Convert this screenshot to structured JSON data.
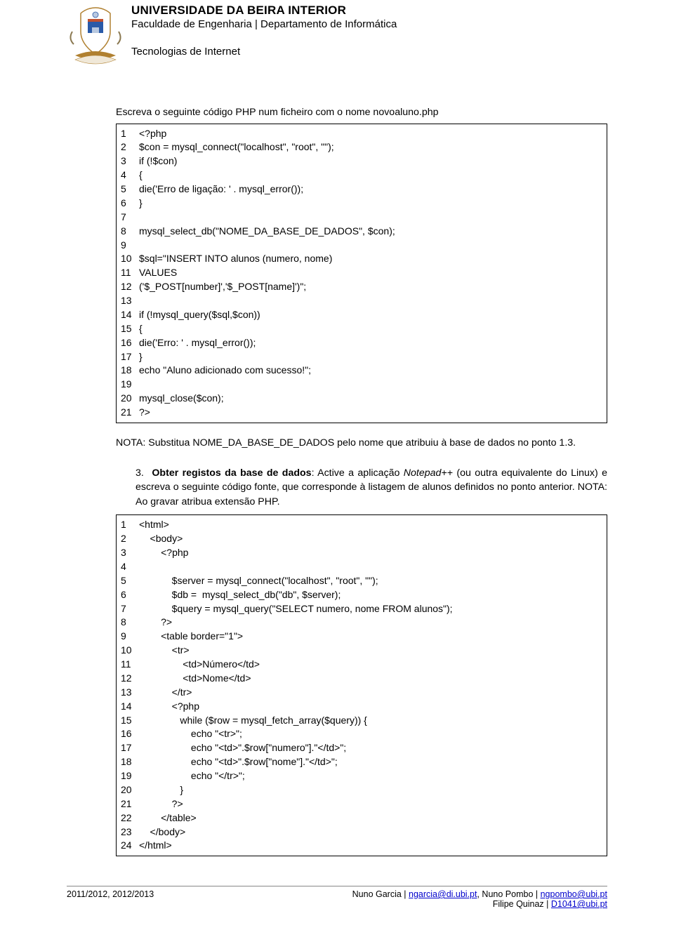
{
  "header": {
    "line1": "UNIVERSIDADE DA BEIRA INTERIOR",
    "line2": "Faculdade de Engenharia | Departamento de Informática",
    "line3": "Tecnologias de Internet"
  },
  "intro": "Escreva o seguinte código PHP num ficheiro com o nome novoaluno.php",
  "code1": {
    "linenums": "1\n2\n3\n4\n5\n6\n7\n8\n9\n10\n11\n12\n13\n14\n15\n16\n17\n18\n19\n20\n21",
    "text": "<?php\n$con = mysql_connect(\"localhost\", \"root\", \"\");\nif (!$con)\n{\ndie('Erro de ligação: ' . mysql_error());\n}\n\nmysql_select_db(\"NOME_DA_BASE_DE_DADOS\", $con);\n\n$sql=\"INSERT INTO alunos (numero, nome)\nVALUES\n('$_POST[number]','$_POST[name]')\";\n\nif (!mysql_query($sql,$con))\n{\ndie('Erro: ' . mysql_error());\n}\necho \"Aluno adicionado com sucesso!\";\n\nmysql_close($con);\n?>"
  },
  "note": "NOTA: Substitua NOME_DA_BASE_DE_DADOS pelo nome que atribuiu à base de dados no ponto 1.3.",
  "step3": {
    "num": "3.",
    "bold": "Obter registos da base de dados",
    "rest1": ": Active a aplicação ",
    "em": "Notepad++",
    "rest2": " (ou outra equivalente do Linux) e escreva o seguinte código fonte, que corresponde à listagem de alunos definidos no ponto anterior. NOTA: Ao gravar atribua extensão PHP."
  },
  "code2": {
    "linenums": "1\n2\n3\n4\n5\n6\n7\n8\n9\n10\n11\n12\n13\n14\n15\n16\n17\n18\n19\n20\n21\n22\n23\n24",
    "text": "<html>\n    <body>\n        <?php\n\n            $server = mysql_connect(\"localhost\", \"root\", \"\");\n            $db =  mysql_select_db(\"db\", $server);\n            $query = mysql_query(\"SELECT numero, nome FROM alunos\");\n        ?>\n        <table border=\"1\">\n            <tr>\n                <td>Número</td>\n                <td>Nome</td>\n            </tr>\n            <?php\n               while ($row = mysql_fetch_array($query)) {\n                   echo \"<tr>\";\n                   echo \"<td>\".$row[\"numero\"].\"</td>\";\n                   echo \"<td>\".$row[\"nome\"].\"</td>\";\n                   echo \"</tr>\";\n               }\n            ?>\n        </table>\n    </body>\n</html>"
  },
  "footer": {
    "left": "2011/2012, 2012/2013",
    "right_a": "Nuno Garcia | ",
    "right_a_link": "ngarcia@di.ubi.pt",
    "right_b": ", Nuno Pombo | ",
    "right_b_link": "ngpombo@ubi.pt",
    "right_c": "Filipe Quinaz | ",
    "right_c_link": "D1041@ubi.pt"
  }
}
